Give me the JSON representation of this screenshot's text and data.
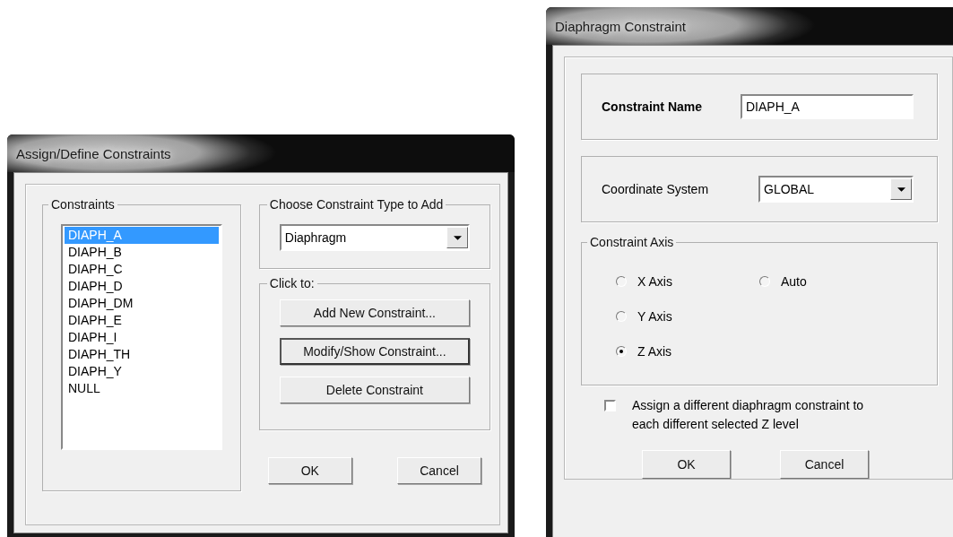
{
  "assign_dialog": {
    "title": "Assign/Define Constraints",
    "constraints": {
      "label": "Constraints",
      "items": [
        {
          "label": "DIAPH_A",
          "selected": true
        },
        {
          "label": "DIAPH_B",
          "selected": false
        },
        {
          "label": "DIAPH_C",
          "selected": false
        },
        {
          "label": "DIAPH_D",
          "selected": false
        },
        {
          "label": "DIAPH_DM",
          "selected": false
        },
        {
          "label": "DIAPH_E",
          "selected": false
        },
        {
          "label": "DIAPH_I",
          "selected": false
        },
        {
          "label": "DIAPH_TH",
          "selected": false
        },
        {
          "label": "DIAPH_Y",
          "selected": false
        },
        {
          "label": "NULL",
          "selected": false
        }
      ]
    },
    "type_group": {
      "label": "Choose Constraint Type to Add",
      "dropdown": {
        "value": "Diaphragm"
      }
    },
    "click_group": {
      "label": "Click to:",
      "buttons": [
        {
          "label": "Add New Constraint...",
          "focused": false
        },
        {
          "label": "Modify/Show Constraint...",
          "focused": true
        },
        {
          "label": "Delete Constraint",
          "focused": false
        }
      ]
    },
    "buttons": [
      "OK",
      "Cancel"
    ]
  },
  "diaphragm_dialog": {
    "title": "Diaphragm Constraint",
    "name_group": {
      "label": "Constraint Name",
      "value": "DIAPH_A"
    },
    "coordinate_group": {
      "label": "Coordinate System",
      "value": "GLOBAL"
    },
    "axis_group": {
      "label": "Constraint Axis",
      "options": [
        {
          "label": "X Axis",
          "selected": false
        },
        {
          "label": "Y Axis",
          "selected": false
        },
        {
          "label": "Z Axis",
          "selected": true
        },
        {
          "label": "Auto",
          "selected": false
        }
      ]
    },
    "checkbox": {
      "label": "Assign a different diaphragm constraint to each different selected Z level",
      "checked": false
    },
    "buttons": [
      "OK",
      "Cancel"
    ]
  }
}
